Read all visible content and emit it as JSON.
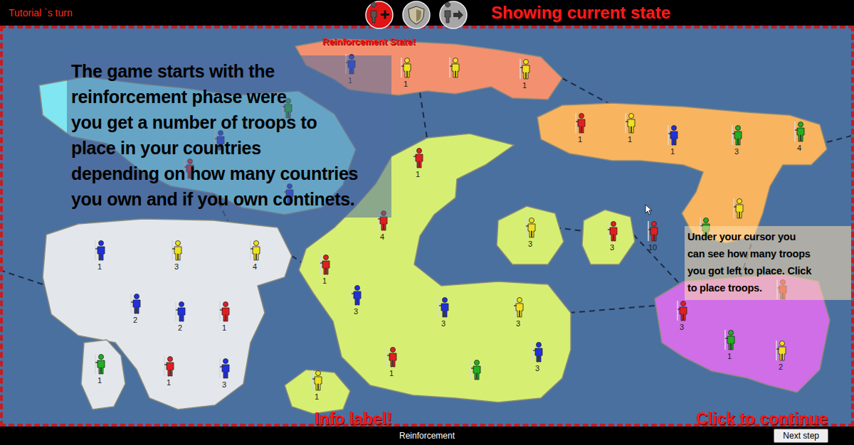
{
  "top_bar": {
    "turn_label": "Tutorial `s turn",
    "state_icons": [
      {
        "selected": true
      },
      {
        "selected": false
      },
      {
        "selected": false
      }
    ],
    "state_caption": "Showing current state",
    "state_label": "Reinforcement State!"
  },
  "tutorial": {
    "main_text": [
      "The game starts with the",
      "reinforcement phase were",
      "you get a number of troops to",
      "place in your countries",
      "depending on how many countries",
      "you own and if you own continets."
    ],
    "cursor_text": [
      "Under your cursor you",
      "can see how many troops",
      "you got left to place. Click",
      "to place troops."
    ],
    "info_caption": "Info label!",
    "continue_caption": "Click to continue"
  },
  "map": {
    "continents": [
      {
        "color": "#f39070",
        "territories": [
          {
            "color": "#2030e0",
            "troops": "1"
          },
          {
            "color": "#f0e020",
            "troops": "1"
          },
          {
            "color": "#f0e020"
          },
          {
            "color": "#f0e020",
            "troops": "1"
          }
        ]
      },
      {
        "color": "#f8b45e",
        "territories": [
          {
            "color": "#e02020",
            "troops": "1"
          },
          {
            "color": "#f0e020",
            "troops": "1"
          },
          {
            "color": "#2030e0",
            "troops": "1"
          },
          {
            "color": "#20b020",
            "troops": "3"
          },
          {
            "color": "#20b020",
            "troops": "4"
          },
          {
            "color": "#20b020"
          },
          {
            "color": "#f0e020"
          }
        ]
      },
      {
        "color": "#7fe6f2",
        "territories": [
          {
            "color": "#20b020"
          },
          {
            "color": "#2030e0"
          },
          {
            "color": "#e02020"
          },
          {
            "color": "#2030e0"
          }
        ]
      },
      {
        "color": "#e3e7ec",
        "territories": [
          {
            "color": "#2030e0",
            "troops": "1"
          },
          {
            "color": "#f0e020",
            "troops": "3"
          },
          {
            "color": "#f0e020",
            "troops": "4"
          },
          {
            "color": "#2030e0",
            "troops": "2"
          },
          {
            "color": "#2030e0",
            "troops": "2"
          },
          {
            "color": "#e02020",
            "troops": "1"
          },
          {
            "color": "#20b020",
            "troops": "1"
          },
          {
            "color": "#e02020",
            "troops": "1"
          },
          {
            "color": "#2030e0",
            "troops": "3"
          }
        ]
      },
      {
        "color": "#d6ef72",
        "territories": [
          {
            "color": "#e02020",
            "troops": "1"
          },
          {
            "color": "#e02020",
            "troops": "4"
          },
          {
            "color": "#e02020",
            "troops": "1"
          },
          {
            "color": "#2030e0",
            "troops": "3"
          },
          {
            "color": "#2030e0",
            "troops": "3"
          },
          {
            "color": "#f0e020",
            "troops": "3"
          },
          {
            "color": "#e02020",
            "troops": "1"
          },
          {
            "color": "#20b020"
          },
          {
            "color": "#2030e0",
            "troops": "3"
          },
          {
            "color": "#f0e020",
            "troops": "3"
          },
          {
            "color": "#e02020",
            "troops": "3"
          },
          {
            "color": "#f0e020",
            "troops": "1"
          }
        ]
      },
      {
        "color": "#cf6ee6",
        "territories": [
          {
            "color": "#e02020",
            "troops": "3"
          },
          {
            "color": "#e02020"
          },
          {
            "color": "#20b020",
            "troops": "1"
          },
          {
            "color": "#f0e020",
            "troops": "2"
          }
        ]
      }
    ],
    "cursor": {
      "color": "#e02020",
      "troops": "10"
    }
  },
  "status_bar": {
    "label": "Reinforcement"
  },
  "buttons": [
    "Next step"
  ]
}
